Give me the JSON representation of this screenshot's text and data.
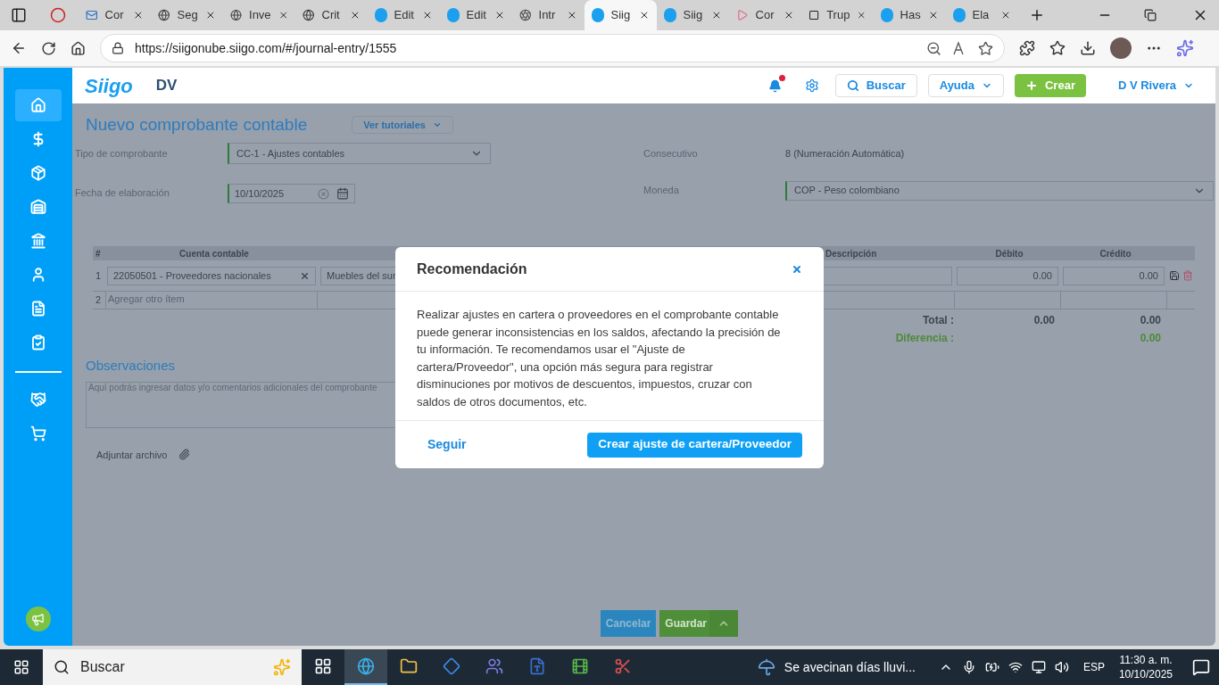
{
  "browser": {
    "tabs": [
      {
        "label": "Cor",
        "kind": "mail",
        "selected": false
      },
      {
        "label": "Seg",
        "kind": "globe",
        "selected": false
      },
      {
        "label": "Inve",
        "kind": "globe",
        "selected": false
      },
      {
        "label": "Crit",
        "kind": "globe",
        "selected": false
      },
      {
        "label": "Edit",
        "kind": "siigo",
        "selected": false
      },
      {
        "label": "Edit",
        "kind": "siigo",
        "selected": false
      },
      {
        "label": "Intr",
        "kind": "spiral",
        "selected": false
      },
      {
        "label": "Siig",
        "kind": "siigo",
        "selected": true
      },
      {
        "label": "Siig",
        "kind": "siigo",
        "selected": false
      },
      {
        "label": "Cor",
        "kind": "video",
        "selected": false
      },
      {
        "label": "Trup",
        "kind": "square",
        "selected": false
      },
      {
        "label": "Has",
        "kind": "siigo",
        "selected": false
      },
      {
        "label": "Ela",
        "kind": "siigo",
        "selected": false
      }
    ],
    "url": "https://siigonube.siigo.com/#/journal-entry/1555"
  },
  "header": {
    "logo": "Siigo",
    "company": "DV",
    "notifications": {
      "has_new": true
    },
    "search_button": "Buscar",
    "help_button": "Ayuda",
    "create_button": "Crear",
    "user": "D V Rivera"
  },
  "sidebar": {
    "items": [
      {
        "selected": true
      },
      {
        "selected": false
      },
      {
        "selected": false
      },
      {
        "selected": false
      },
      {
        "selected": false
      },
      {
        "selected": false
      },
      {
        "selected": false
      },
      {
        "selected": false
      },
      {
        "selected": false
      },
      {
        "selected": false
      }
    ]
  },
  "form": {
    "title": "Nuevo comprobante contable",
    "tutorials_button": "Ver tutoriales",
    "voucher_type": {
      "label": "Tipo de comprobante",
      "value": "CC-1 - Ajustes contables"
    },
    "date": {
      "label": "Fecha de elaboración",
      "value": "10/10/2025"
    },
    "sequence": {
      "label": "Consecutivo",
      "value": "8 (Numeración Automática)"
    },
    "currency": {
      "label": "Moneda",
      "value": "COP - Peso colombiano"
    }
  },
  "table": {
    "columns": [
      "#",
      "Cuenta contable",
      "Descripción",
      "Débito",
      "Crédito"
    ],
    "rows": [
      {
        "number": "1",
        "account": "22050501 - Proveedores nacionales",
        "third_party": "Muebles del sur",
        "debit": "0.00",
        "credit": "0.00"
      }
    ],
    "new_row": {
      "number": "2",
      "placeholder": "Agregar otro ítem"
    },
    "total_label": "Total :",
    "total_debit": "0.00",
    "total_credit": "0.00",
    "difference_label": "Diferencia :",
    "difference": "0.00"
  },
  "observations": {
    "title": "Observaciones",
    "placeholder": "Aquí podrás ingresar datos y/o comentarios adicionales del comprobante"
  },
  "attach": "Adjuntar archivo",
  "footer": {
    "cancel": "Cancelar",
    "save": "Guardar"
  },
  "modal": {
    "title": "Recomendación",
    "body": "Realizar ajustes en cartera o proveedores en el comprobante contable puede generar inconsistencias en los saldos, afectando la precisión de tu información. Te recomendamos usar el \"Ajuste de cartera/Proveedor\", una opción más segura para registrar disminuciones por motivos de descuentos, impuestos, cruzar con saldos de otros documentos, etc.",
    "secondary": "Seguir",
    "primary": "Crear ajuste de cartera/Proveedor"
  },
  "taskbar": {
    "search": "Buscar",
    "apps": [
      {
        "selected": false
      },
      {
        "selected": true
      },
      {
        "selected": false
      },
      {
        "selected": false
      },
      {
        "selected": false
      },
      {
        "selected": false
      },
      {
        "selected": false
      },
      {
        "selected": false
      }
    ],
    "weather": "Se avecinan días lluvi...",
    "language": "ESP",
    "time": "11:30 a. m.",
    "date": "10/10/2025"
  }
}
